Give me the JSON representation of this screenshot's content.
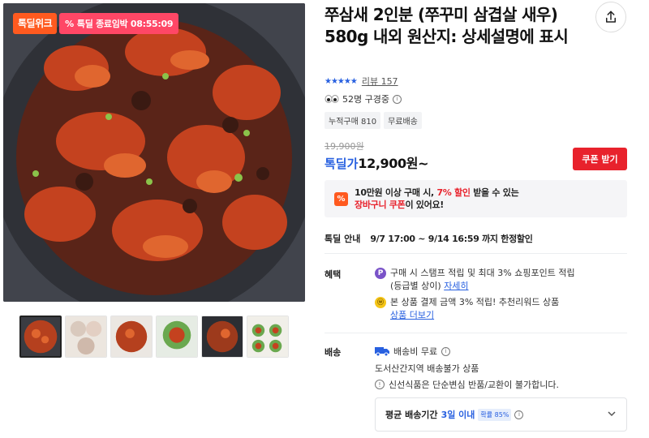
{
  "badges": {
    "week": "톡딜위크",
    "timer_icon": "%",
    "timer": "톡딜 종료임박 08:55:09"
  },
  "product": {
    "title": "쭈삼새 2인분 (쭈꾸미 삼겹살 새우) 580g 내외 원산지: 상세설명에 표시",
    "rating_stars": "★★★★★",
    "review_link": "리뷰 157",
    "viewers": "52명 구경중",
    "tags": [
      "누적구매 810",
      "무료배송"
    ]
  },
  "price": {
    "original": "19,900원",
    "sale_label": "톡딜가",
    "sale_price": "12,900원~",
    "coupon_button": "쿠폰 받기"
  },
  "promo": {
    "icon": "%",
    "line1_a": "10만원 이상 구매 시, ",
    "line1_b": "7% 할인",
    "line1_c": " 받을 수 있는",
    "line2_a": "장바구니 쿠폰",
    "line2_b": "이 있어요!"
  },
  "deal": {
    "label": "톡딜 안내",
    "period": "9/7 17:00 ~ 9/14 16:59 까지 한정할인"
  },
  "benefits": {
    "label": "혜택",
    "item1_icon": "P",
    "item1_text": "구매 시 스탬프 적립 및 최대 3% 쇼핑포인트 적립",
    "item1_sub": "(등급별 상이)",
    "item1_link": "자세히",
    "item2_icon": "ⓦ",
    "item2_text": "본 상품 결제 금액 3% 적립! 추천리워드 상품",
    "item2_link": "상품 더보기"
  },
  "shipping": {
    "label": "배송",
    "fee": "배송비 무료",
    "line2": "도서산간지역 배송불가 상품",
    "line3": "신선식품은 단순변심 반품/교환이 불가합니다.",
    "avg_label": "평균 배송기간",
    "avg_days": "3일 이내",
    "avg_prob": "확률 85%"
  },
  "colors": {
    "accent_blue": "#2860e0",
    "coupon_red": "#e8222c",
    "week_orange": "#ff5a1f",
    "timer_pink": "#ff4766"
  }
}
